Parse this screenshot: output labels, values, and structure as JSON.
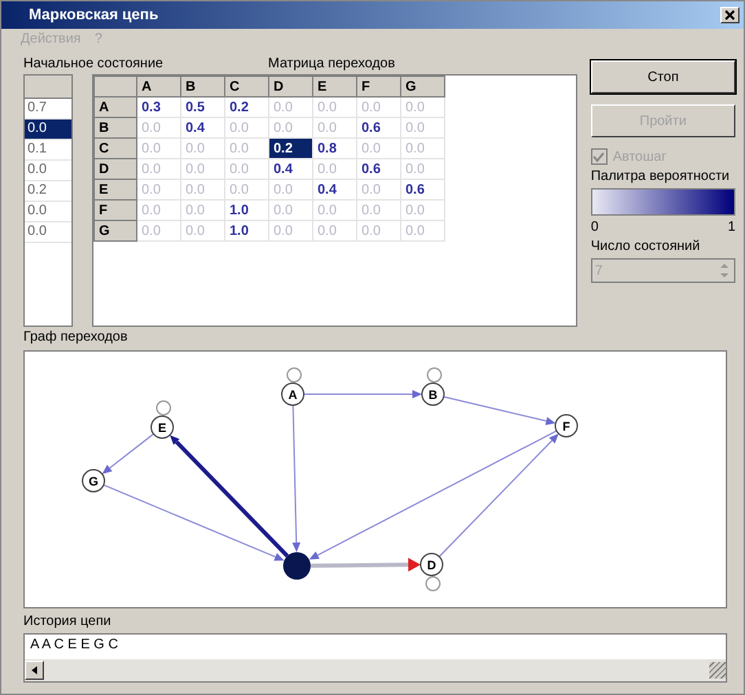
{
  "window": {
    "title": "Марковская цепь"
  },
  "menu": [
    {
      "label": "Действия",
      "disabled": true
    },
    {
      "label": "?",
      "disabled": true
    }
  ],
  "initial_state": {
    "label": "Начальное состояние",
    "values": [
      {
        "value": "0.7",
        "selected": false
      },
      {
        "value": "0.0",
        "selected": true
      },
      {
        "value": "0.1",
        "selected": false
      },
      {
        "value": "0.0",
        "selected": false
      },
      {
        "value": "0.2",
        "selected": false
      },
      {
        "value": "0.0",
        "selected": false
      },
      {
        "value": "0.0",
        "selected": false
      }
    ]
  },
  "matrix": {
    "label": "Матрица переходов",
    "columns": [
      "A",
      "B",
      "C",
      "D",
      "E",
      "F",
      "G"
    ],
    "rows": [
      {
        "header": "A",
        "cells": [
          {
            "value": "0.3",
            "selected": false
          },
          {
            "value": "0.5",
            "selected": false
          },
          {
            "value": "0.2",
            "selected": false
          },
          {
            "value": "0.0",
            "selected": false
          },
          {
            "value": "0.0",
            "selected": false
          },
          {
            "value": "0.0",
            "selected": false
          },
          {
            "value": "0.0",
            "selected": false
          }
        ]
      },
      {
        "header": "B",
        "cells": [
          {
            "value": "0.0",
            "selected": false
          },
          {
            "value": "0.4",
            "selected": false
          },
          {
            "value": "0.0",
            "selected": false
          },
          {
            "value": "0.0",
            "selected": false
          },
          {
            "value": "0.0",
            "selected": false
          },
          {
            "value": "0.6",
            "selected": false
          },
          {
            "value": "0.0",
            "selected": false
          }
        ]
      },
      {
        "header": "C",
        "cells": [
          {
            "value": "0.0",
            "selected": false
          },
          {
            "value": "0.0",
            "selected": false
          },
          {
            "value": "0.0",
            "selected": false
          },
          {
            "value": "0.2",
            "selected": true
          },
          {
            "value": "0.8",
            "selected": false
          },
          {
            "value": "0.0",
            "selected": false
          },
          {
            "value": "0.0",
            "selected": false
          }
        ]
      },
      {
        "header": "D",
        "cells": [
          {
            "value": "0.0",
            "selected": false
          },
          {
            "value": "0.0",
            "selected": false
          },
          {
            "value": "0.0",
            "selected": false
          },
          {
            "value": "0.4",
            "selected": false
          },
          {
            "value": "0.0",
            "selected": false
          },
          {
            "value": "0.6",
            "selected": false
          },
          {
            "value": "0.0",
            "selected": false
          }
        ]
      },
      {
        "header": "E",
        "cells": [
          {
            "value": "0.0",
            "selected": false
          },
          {
            "value": "0.0",
            "selected": false
          },
          {
            "value": "0.0",
            "selected": false
          },
          {
            "value": "0.0",
            "selected": false
          },
          {
            "value": "0.4",
            "selected": false
          },
          {
            "value": "0.0",
            "selected": false
          },
          {
            "value": "0.6",
            "selected": false
          }
        ]
      },
      {
        "header": "F",
        "cells": [
          {
            "value": "0.0",
            "selected": false
          },
          {
            "value": "0.0",
            "selected": false
          },
          {
            "value": "1.0",
            "selected": false
          },
          {
            "value": "0.0",
            "selected": false
          },
          {
            "value": "0.0",
            "selected": false
          },
          {
            "value": "0.0",
            "selected": false
          },
          {
            "value": "0.0",
            "selected": false
          }
        ]
      },
      {
        "header": "G",
        "cells": [
          {
            "value": "0.0",
            "selected": false
          },
          {
            "value": "0.0",
            "selected": false
          },
          {
            "value": "1.0",
            "selected": false
          },
          {
            "value": "0.0",
            "selected": false
          },
          {
            "value": "0.0",
            "selected": false
          },
          {
            "value": "0.0",
            "selected": false
          },
          {
            "value": "0.0",
            "selected": false
          }
        ]
      }
    ]
  },
  "buttons": [
    {
      "label": "Стоп",
      "disabled": false
    },
    {
      "label": "Пройти",
      "disabled": true
    }
  ],
  "autostep": {
    "label": "Автошаг",
    "checked": true,
    "disabled": true
  },
  "palette": {
    "label": "Палитра вероятности",
    "min": "0",
    "max": "1"
  },
  "state_count": {
    "label": "Число состояний",
    "value": "7",
    "disabled": true
  },
  "graph": {
    "label": "Граф переходов",
    "nodes": [
      {
        "label": "A",
        "current": false
      },
      {
        "label": "B",
        "current": false
      },
      {
        "current": true
      },
      {
        "label": "D",
        "current": false
      },
      {
        "label": "E",
        "current": false
      },
      {
        "label": "F",
        "current": false
      },
      {
        "label": "G",
        "current": false
      }
    ],
    "edges": [
      {
        "kind": "loop"
      },
      {
        "kind": "loop"
      },
      {
        "kind": "loop"
      },
      {
        "kind": "loop"
      },
      {
        "kind": "normal"
      },
      {
        "kind": "normal"
      },
      {
        "kind": "normal"
      },
      {
        "kind": "normal"
      },
      {
        "kind": "normal"
      },
      {
        "kind": "normal"
      },
      {
        "kind": "normal"
      },
      {
        "kind": "strong"
      },
      {
        "kind": "next"
      }
    ]
  },
  "history": {
    "label": "История цепи",
    "value": "A A C E E G C"
  }
}
